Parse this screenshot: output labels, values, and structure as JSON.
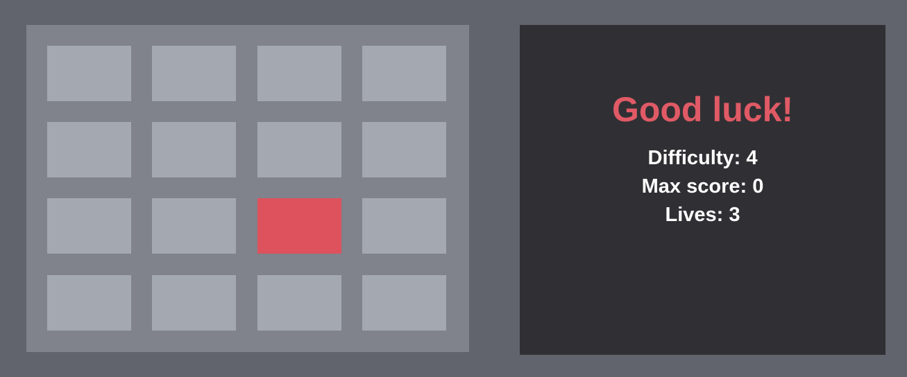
{
  "game": {
    "grid": {
      "rows": 4,
      "cols": 4,
      "active_tile": {
        "row": 3,
        "col": 3
      }
    },
    "status": {
      "message": "Good luck!",
      "difficulty_text": "Difficulty: 4",
      "max_score_text": "Max score: 0",
      "lives_text": "Lives: 3"
    },
    "colors": {
      "background": "#61646c",
      "board": "#80838c",
      "tile": "#a4a9b1",
      "tile_active": "#dd525c",
      "panel": "#303034",
      "message": "#e05a66",
      "stats_text": "#ffffff"
    }
  }
}
